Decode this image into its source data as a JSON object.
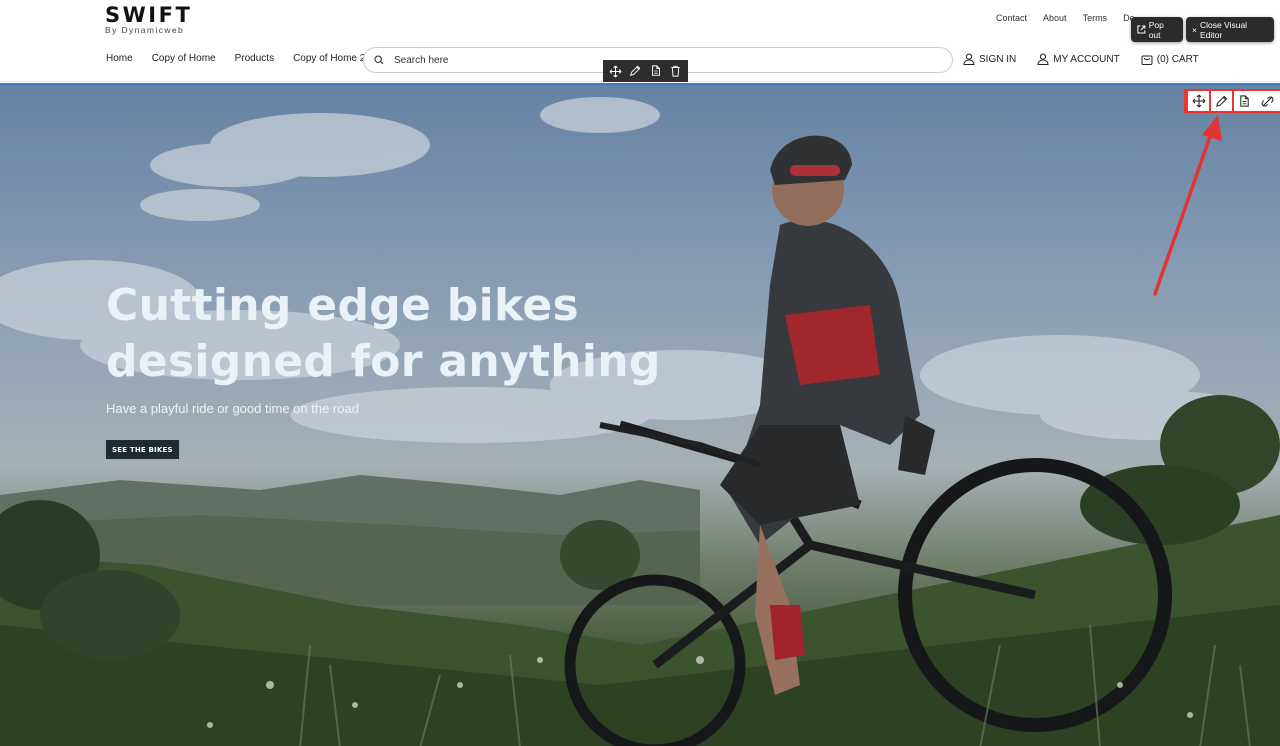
{
  "brand": {
    "name": "SWIFT",
    "tagline": "By Dynamicweb"
  },
  "top_links": [
    "Contact",
    "About",
    "Terms",
    "De"
  ],
  "editor": {
    "pop_out_label": "Pop out",
    "close_label": "Close Visual Editor"
  },
  "nav": {
    "items": [
      "Home",
      "Copy of Home",
      "Products",
      "Copy of Home 2"
    ]
  },
  "search": {
    "placeholder": "Search here",
    "value": ""
  },
  "account": {
    "sign_in": "SIGN IN",
    "my_account": "MY ACCOUNT",
    "cart": "(0) CART"
  },
  "hero": {
    "title": "Cutting edge bikes designed for anything",
    "subtitle": "Have a playful ride or good time on the road",
    "button_label": "SEE THE BIKES"
  },
  "toolbar_icons": [
    "move-icon",
    "edit-pencil-icon",
    "copy-icon",
    "delete-icon"
  ],
  "hero_toolbar_icons": [
    "move-icon",
    "edit-pencil-icon",
    "copy-icon",
    "unlink-icon",
    "delete-icon"
  ],
  "colors": {
    "accent_red": "#e33333",
    "toolbar_dark": "#2e2e2e",
    "selection_blue": "#3c78c4"
  }
}
